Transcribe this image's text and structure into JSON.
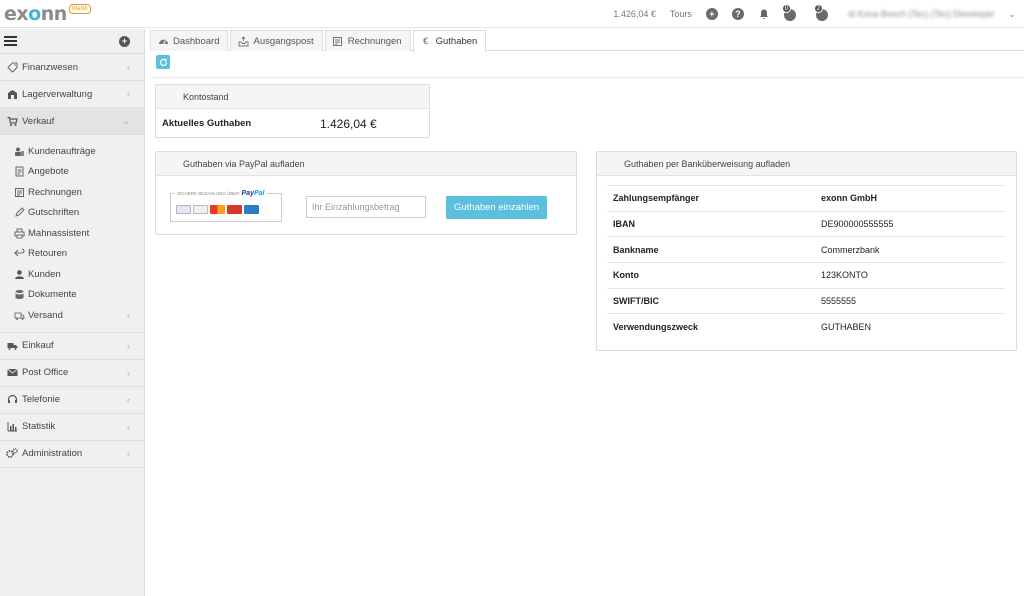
{
  "header": {
    "logo_text": "exonn",
    "logo_badge": "WaWi",
    "balance": "1.426,04 €",
    "tours_label": "Tours",
    "messages_count": "0",
    "chat_count": "2",
    "user_name": "di Kona Bosch (Tec) (Tec) Developer"
  },
  "sidebar": {
    "items_top": [
      {
        "label": "Finanzwesen",
        "icon": "tag-icon"
      },
      {
        "label": "Lagerverwaltung",
        "icon": "warehouse-icon"
      }
    ],
    "verkauf": {
      "label": "Verkauf",
      "icon": "cart-icon"
    },
    "sub_items": [
      {
        "label": "Kundenaufträge"
      },
      {
        "label": "Angebote"
      },
      {
        "label": "Rechnungen"
      },
      {
        "label": "Gutschriften"
      },
      {
        "label": "Mahnassistent"
      },
      {
        "label": "Retouren"
      },
      {
        "label": "Kunden"
      },
      {
        "label": "Dokumente"
      },
      {
        "label": "Versand"
      }
    ],
    "items_bottom": [
      {
        "label": "Einkauf"
      },
      {
        "label": "Post Office"
      },
      {
        "label": "Telefonie"
      },
      {
        "label": "Statistik"
      },
      {
        "label": "Administration"
      }
    ]
  },
  "tabs": [
    {
      "label": "Dashboard"
    },
    {
      "label": "Ausgangspost"
    },
    {
      "label": "Rechnungen"
    },
    {
      "label": "Guthaben"
    }
  ],
  "kontostand": {
    "title": "Kontostand",
    "label": "Aktuelles Guthaben",
    "value": "1.426,04 €"
  },
  "paypal": {
    "title": "Guthaben via PayPal aufladen",
    "logo_caption": "SICHERE BEZAHLUNG ÜBER",
    "logo_brand_a": "Pay",
    "logo_brand_b": "Pal",
    "input_placeholder": "Ihr Einzahlungsbetrag",
    "button_label": "Guthaben einzahlen"
  },
  "bank": {
    "title": "Guthaben per Banküberweisung aufladen",
    "rows": [
      {
        "key": "Zahlungsempfänger",
        "value": "exonn GmbH"
      },
      {
        "key": "IBAN",
        "value": "DE900000555555"
      },
      {
        "key": "Bankname",
        "value": "Commerzbank"
      },
      {
        "key": "Konto",
        "value": "123KONTO"
      },
      {
        "key": "SWIFT/BIC",
        "value": "5555555"
      },
      {
        "key": "Verwendungszweck",
        "value": "GUTHABEN"
      }
    ]
  },
  "colors": {
    "accent": "#5bc0de",
    "logo_accent": "#44b4d4",
    "badge": "#e39a1a"
  }
}
